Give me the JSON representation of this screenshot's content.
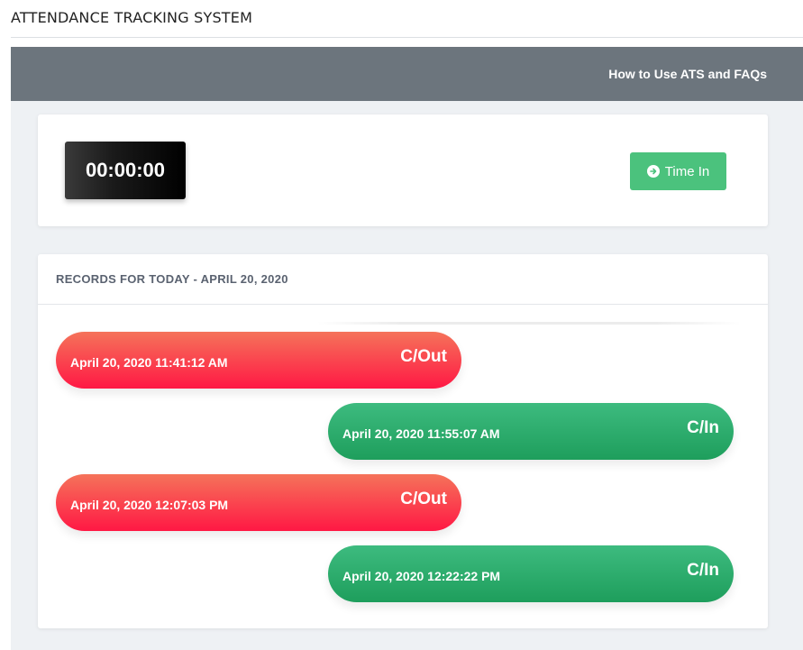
{
  "app": {
    "title": "ATTENDANCE TRACKING SYSTEM"
  },
  "nav": {
    "help_link": "How to Use ATS and FAQs"
  },
  "timer": {
    "display": "00:00:00"
  },
  "actions": {
    "time_in_label": "Time In",
    "time_in_icon": "arrow-circle-right-icon"
  },
  "records": {
    "header": "RECORDS FOR TODAY - APRIL 20, 2020",
    "items": [
      {
        "timestamp": "April 20, 2020 11:41:12 AM",
        "type": "C/Out"
      },
      {
        "timestamp": "April 20, 2020 11:55:07 AM",
        "type": "C/In"
      },
      {
        "timestamp": "April 20, 2020 12:07:03 PM",
        "type": "C/Out"
      },
      {
        "timestamp": "April 20, 2020 12:22:22 PM",
        "type": "C/In"
      }
    ]
  },
  "colors": {
    "navbar": "#6c757d",
    "time_in_button": "#4bc27d",
    "clock_out_pill": "#ff1844",
    "clock_in_pill": "#1e9e5c"
  }
}
